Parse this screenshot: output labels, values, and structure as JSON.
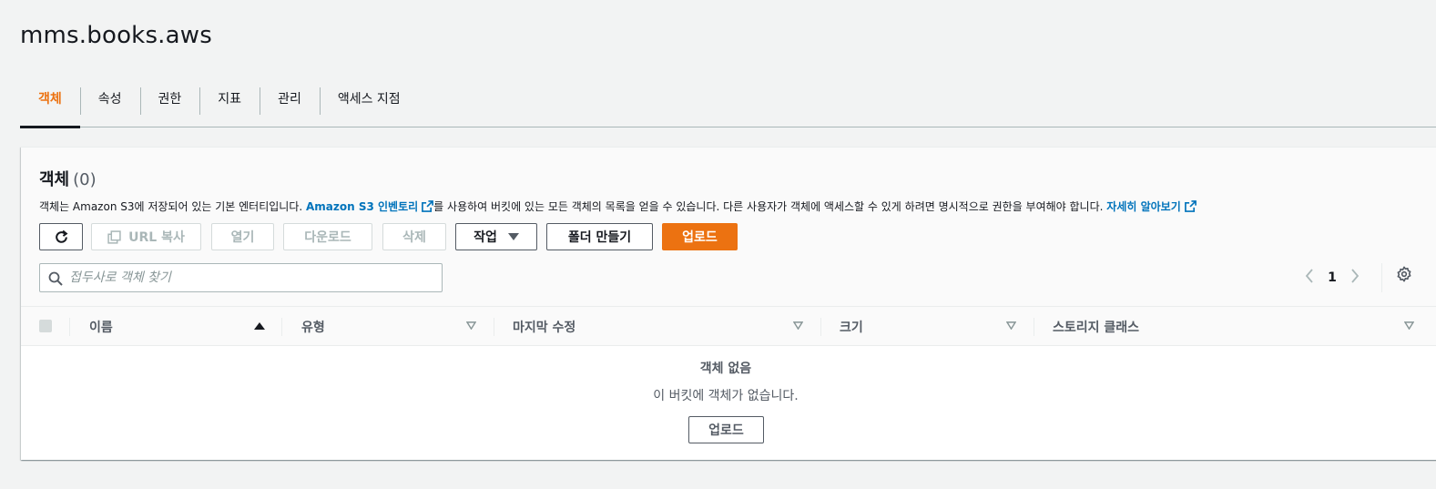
{
  "bucket": {
    "title": "mms.books.aws"
  },
  "tabs": [
    {
      "label": "객체",
      "active": true
    },
    {
      "label": "속성"
    },
    {
      "label": "권한"
    },
    {
      "label": "지표"
    },
    {
      "label": "관리"
    },
    {
      "label": "액세스 지점"
    }
  ],
  "objects": {
    "title": "객체",
    "count": "(0)",
    "description": {
      "before": "객체는 Amazon S3에 저장되어 있는 기본 엔터티입니다. ",
      "link1": "Amazon S3 인벤토리",
      "middle": "를 사용하여 버킷에 있는 모든 객체의 목록을 얻을 수 있습니다. 다른 사용자가 객체에 액세스할 수 있게 하려면 명시적으로 권한을 부여해야 합니다. ",
      "link2": "자세히 알아보기"
    },
    "toolbar": {
      "refresh_icon": "refresh-icon",
      "copy_url": "URL 복사",
      "open": "열기",
      "download": "다운로드",
      "delete": "삭제",
      "actions": "작업",
      "create_folder": "폴더 만들기",
      "upload": "업로드"
    },
    "search": {
      "placeholder": "접두사로 객체 찾기",
      "value": ""
    },
    "pagination": {
      "current_page": "1"
    },
    "columns": [
      {
        "label": "이름",
        "sort": "ascending"
      },
      {
        "label": "유형"
      },
      {
        "label": "마지막 수정"
      },
      {
        "label": "크기"
      },
      {
        "label": "스토리지 클래스"
      }
    ],
    "empty": {
      "title": "객체 없음",
      "description": "이 버킷에 객체가 없습니다.",
      "upload": "업로드"
    }
  },
  "colors": {
    "accent": "#ec7211",
    "link": "#0073bb",
    "text": "#16191f",
    "muted": "#545b64"
  }
}
